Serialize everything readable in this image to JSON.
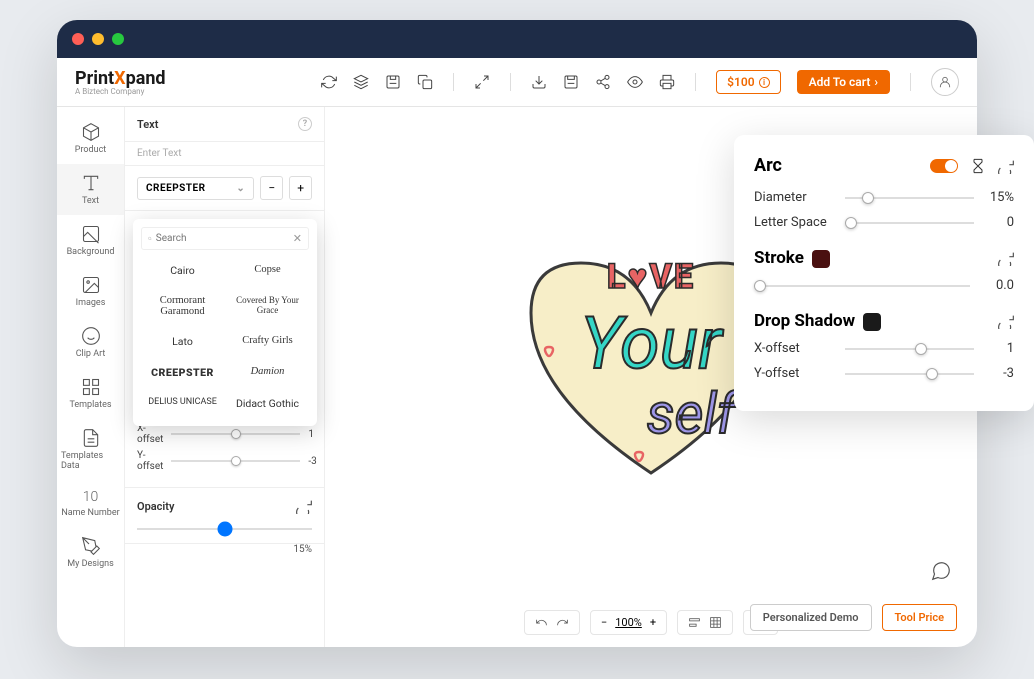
{
  "logo": {
    "pre": "Print",
    "x": "X",
    "post": "pand",
    "sub": "A Biztech Company"
  },
  "header": {
    "price": "$100",
    "cart": "Add To cart"
  },
  "sidebar": [
    {
      "label": "Product"
    },
    {
      "label": "Text"
    },
    {
      "label": "Background"
    },
    {
      "label": "Images"
    },
    {
      "label": "Clip Art"
    },
    {
      "label": "Templates"
    },
    {
      "label": "Templates Data"
    },
    {
      "label": "Name Number"
    },
    {
      "label": "My Designs"
    }
  ],
  "textpanel": {
    "title": "Text",
    "placeholder": "Enter Text",
    "font": "CREEPSTER",
    "search_placeholder": "Search",
    "fonts": [
      "Cairo",
      "Copse",
      "Cormorant Garamond",
      "Covered By Your Grace",
      "Lato",
      "Crafty Girls",
      "CREEPSTER",
      "Damion",
      "DELIUS UNICASE",
      "Didact Gothic"
    ],
    "dropshadow": {
      "title": "Drop Shadow",
      "color": "#4a2410",
      "x_label": "X-offset",
      "x_val": "1",
      "y_label": "Y-offset",
      "y_val": "-3"
    },
    "opacity": {
      "title": "Opacity",
      "val": "15%"
    }
  },
  "canvas": {
    "zoom": "100%"
  },
  "floating": {
    "arc": {
      "title": "Arc",
      "diameter_label": "Diameter",
      "diameter_val": "15%",
      "letter_label": "Letter Space",
      "letter_val": "0"
    },
    "stroke": {
      "title": "Stroke",
      "color": "#4a1010",
      "val": "0.0"
    },
    "dropshadow": {
      "title": "Drop Shadow",
      "color": "#1a1a1a",
      "x_label": "X-offset",
      "x_val": "1",
      "y_label": "Y-offset",
      "y_val": "-3"
    }
  },
  "bottom": {
    "demo": "Personalized Demo",
    "tool": "Tool Price"
  }
}
